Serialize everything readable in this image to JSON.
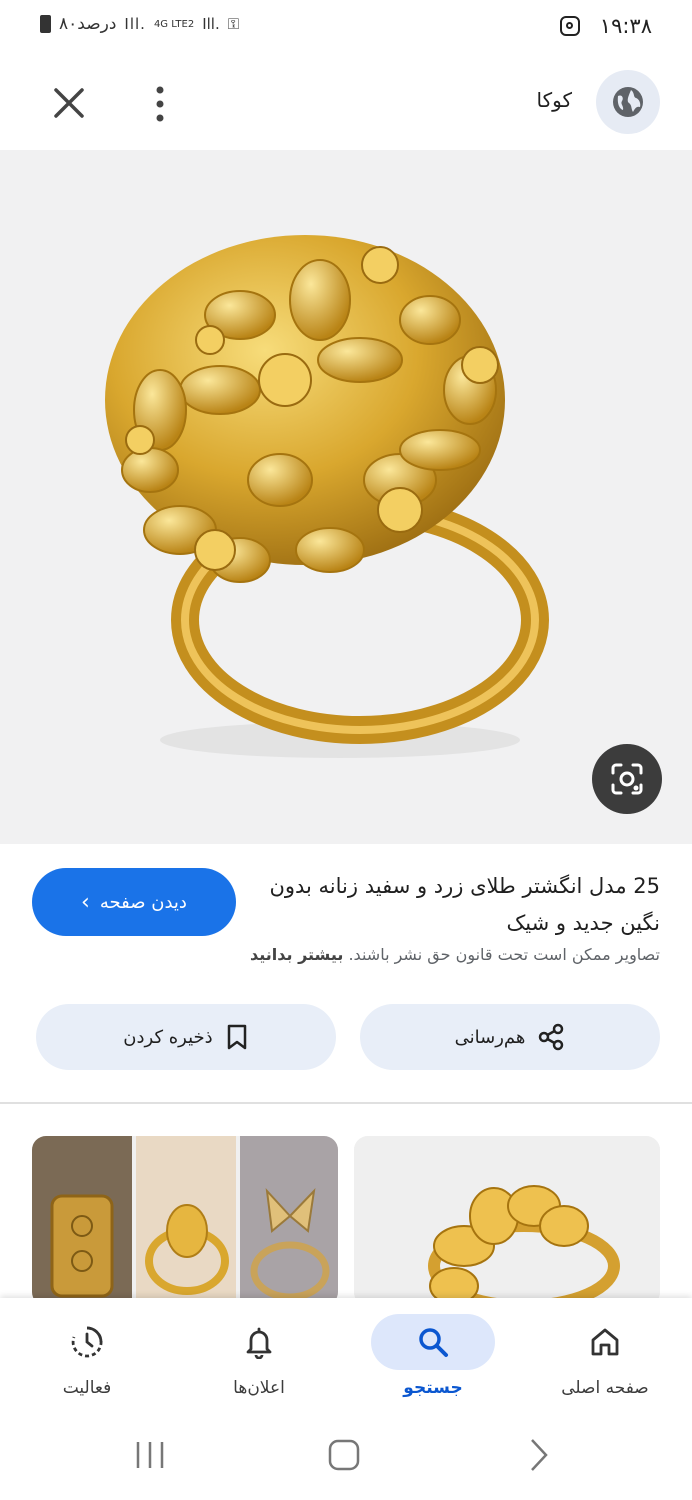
{
  "status_bar": {
    "time": "۱۹:۳۸",
    "battery": "۸۰درصد",
    "network": "4G LTE2"
  },
  "header": {
    "site": "کوکا"
  },
  "result": {
    "title": "25 مدل انگشتر طلای زرد و سفید زنانه بدون نگین جدید و شیک",
    "copyright": "تصاویر ممکن است تحت قانون حق نشر باشند.",
    "learn_more": "بیشتر بدانید",
    "visit_label": "دیدن صفحه",
    "share_label": "هم‌رسانی",
    "save_label": "ذخیره کردن"
  },
  "bottom_nav": {
    "items": [
      {
        "label": "صفحه اصلی",
        "icon": "home-icon"
      },
      {
        "label": "جستجو",
        "icon": "search-icon",
        "active": true
      },
      {
        "label": "اعلان‌ها",
        "icon": "bell-icon"
      },
      {
        "label": "فعالیت",
        "icon": "activity-icon"
      }
    ]
  },
  "colors": {
    "accent": "#1a73e8",
    "pill_bg": "#e8eef8",
    "active_nav_bg": "#dde7fb",
    "gold": "#d9a72e"
  }
}
